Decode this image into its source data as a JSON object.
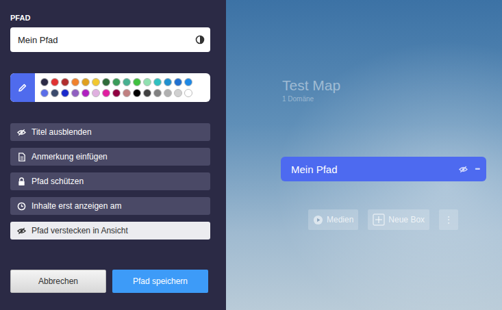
{
  "panel": {
    "title": "PFAD",
    "name_field": {
      "value": "Mein Pfad"
    },
    "swatches": [
      {
        "color": "#2b2a45"
      },
      {
        "color": "#e03232"
      },
      {
        "color": "#b02e2e"
      },
      {
        "color": "#f0822e"
      },
      {
        "color": "#e0a020"
      },
      {
        "color": "#f2c830"
      },
      {
        "color": "#2f6b3a"
      },
      {
        "color": "#3a9b5a"
      },
      {
        "color": "#48b090"
      },
      {
        "color": "#40c040"
      },
      {
        "color": "#90e0b0"
      },
      {
        "color": "#30c0c0"
      },
      {
        "color": "#2090d0"
      },
      {
        "color": "#2070d0"
      },
      {
        "color": "#1e88e5"
      },
      {
        "color": "#5b6ee8"
      },
      {
        "color": "#3b4a6b"
      },
      {
        "color": "#1a2acb"
      },
      {
        "color": "#9060c0"
      },
      {
        "color": "#b020c0"
      },
      {
        "color": "#e0b0e0"
      },
      {
        "color": "#e020a0"
      },
      {
        "color": "#900040"
      },
      {
        "color": "#c08080"
      },
      {
        "color": "#000000"
      },
      {
        "color": "#404040"
      },
      {
        "color": "#808080"
      },
      {
        "color": "#b0b0b0"
      },
      {
        "color": "#d0d0d0"
      },
      {
        "color": "#ffffff"
      }
    ],
    "options": [
      {
        "label": "Titel ausblenden",
        "kind": "hide",
        "active": false
      },
      {
        "label": "Anmerkung einfügen",
        "kind": "note",
        "active": false
      },
      {
        "label": "Pfad schützen",
        "kind": "lock",
        "active": false
      },
      {
        "label": "Inhalte erst anzeigen am",
        "kind": "clock",
        "active": false
      },
      {
        "label": "Pfad verstecken in Ansicht",
        "kind": "hide",
        "active": true
      }
    ],
    "buttons": [
      {
        "label": "Abbrechen",
        "kind": "secondary"
      },
      {
        "label": "Pfad speichern",
        "kind": "primary"
      }
    ]
  },
  "canvas": {
    "map_title": "Test Map",
    "map_subtitle": "1 Domäne",
    "path": {
      "title": "Mein Pfad",
      "menu": "•••"
    },
    "actions": [
      {
        "label": "Medien",
        "kind": "play"
      },
      {
        "label": "Neue Box",
        "kind": "plus"
      },
      {
        "label": "⋮",
        "kind": "more"
      }
    ]
  }
}
